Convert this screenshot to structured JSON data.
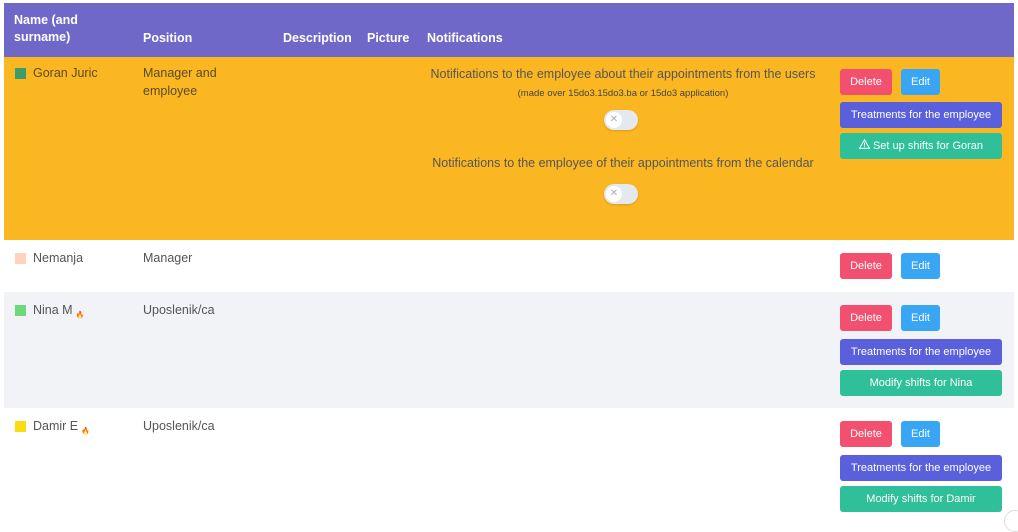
{
  "headers": {
    "name": "Name (and surname)",
    "position": "Position",
    "description": "Description",
    "picture": "Picture",
    "notifications": "Notifications"
  },
  "colors": {
    "header_bg": "#7068c8",
    "highlight_row": "#fbb721",
    "alt_row": "#f2f3f6",
    "delete": "#f2506e",
    "edit": "#38a5f5",
    "treatments": "#5a5fdc",
    "shifts": "#2fc09a"
  },
  "employees": [
    {
      "name": "Goran Juric",
      "swatch": "#3f9a6c",
      "position": "Manager and employee",
      "notifications": {
        "users_label": "Notifications to the employee about their appointments from the users",
        "users_sub": "(made over 15do3.15do3.ba or 15do3 application)",
        "calendar_label": "Notifications to the employee of their appointments from the calendar"
      },
      "delete_label": "Delete",
      "edit_label": "Edit",
      "treatments_label": "Treatments for the employee",
      "shifts_label": "Set up shifts for Goran",
      "shifts_icon": "warning-icon"
    },
    {
      "name": "Nemanja",
      "swatch": "#fdd3bd",
      "position": "Manager",
      "delete_label": "Delete",
      "edit_label": "Edit"
    },
    {
      "name": "Nina M",
      "swatch": "#6ed87c",
      "position": "Uposlenik/ca",
      "delete_label": "Delete",
      "edit_label": "Edit",
      "treatments_label": "Treatments for the employee",
      "shifts_label": "Modify shifts for Nina"
    },
    {
      "name": "Damir E",
      "swatch": "#f9dd12",
      "position": "Uposlenik/ca",
      "delete_label": "Delete",
      "edit_label": "Edit",
      "treatments_label": "Treatments for the employee",
      "shifts_label": "Modify shifts for Damir"
    }
  ]
}
